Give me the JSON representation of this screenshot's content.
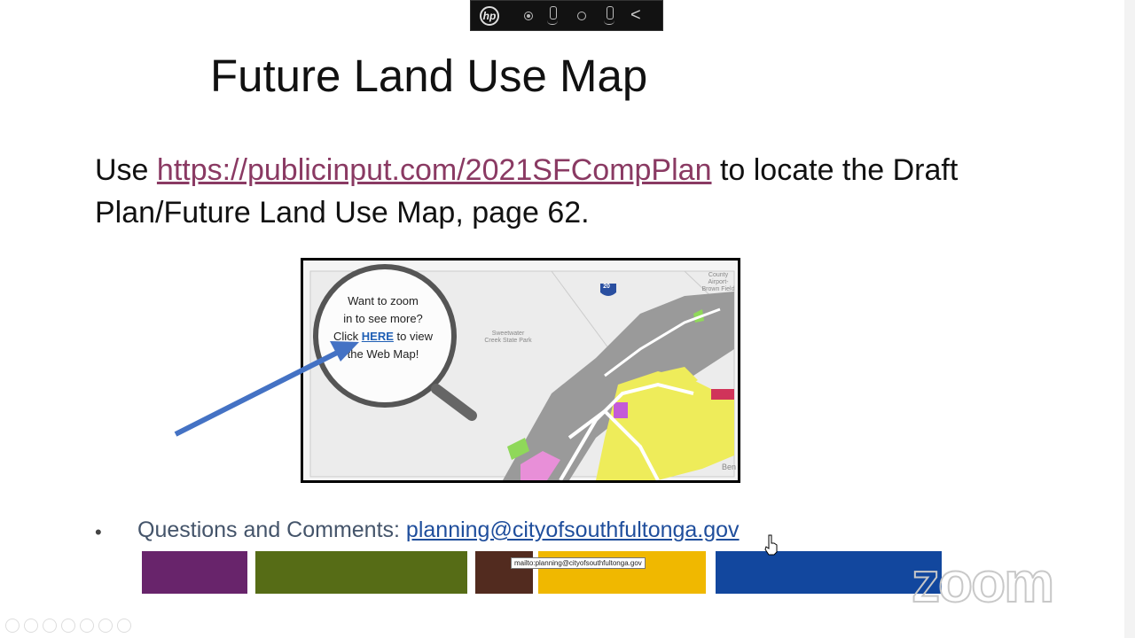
{
  "toolbar": {
    "hp_logo": "hp",
    "icons": [
      "hp-logo-icon",
      "record-dot-icon",
      "mic-icon",
      "circle-icon",
      "mic-waves-icon",
      "chevron-left-icon"
    ],
    "chevron": "<"
  },
  "slide": {
    "title": "Future Land Use Map",
    "intro_before": "Use ",
    "link_url": "https://publicinput.com/2021SFCompPlan",
    "intro_after": " to locate the Draft Plan/Future Land Use Map, page 62.",
    "map_callout": {
      "line1": "Want to zoom",
      "line2": "in to see more?",
      "click": "Click ",
      "here": "HERE",
      "to_view": " to view",
      "line4": "the Web Map!"
    },
    "map_labels": {
      "interstate": "20",
      "park": "Sweetwater Creek State Park",
      "airport": "County Airport-Brown Field",
      "corner": "Ben"
    },
    "bullet": "•",
    "comments_label": "Questions and Comments: ",
    "comments_email": "planning@cityofsouthfultonga.gov",
    "tooltip": "mailto:planning@cityofsouthfultonga.gov",
    "color_bars": [
      "#68246b",
      "#566c16",
      "#522b1f",
      "#f0b800",
      "#12479e"
    ]
  },
  "watermark": "zoom"
}
